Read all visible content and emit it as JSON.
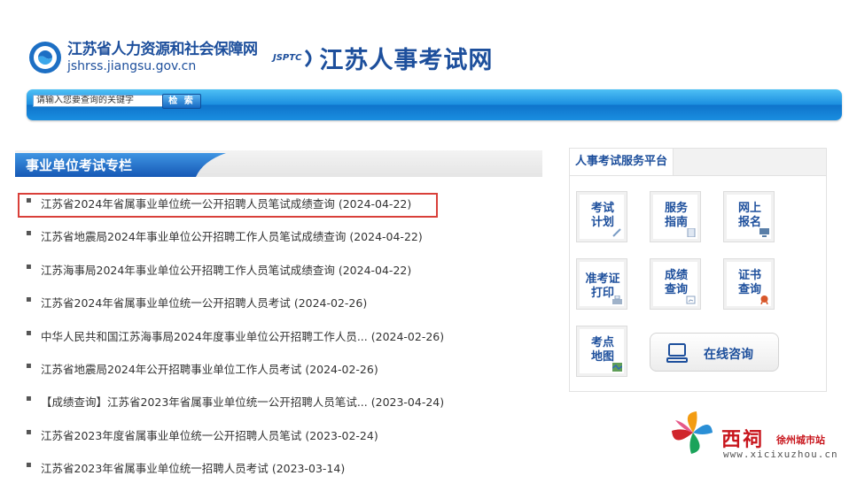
{
  "header": {
    "hrss_name": "江苏省人力资源和社会保障网",
    "hrss_url": "jshrss.jiangsu.gov.cn",
    "jsptc_abbr": "JSPTC",
    "site_name": "江苏人事考试网"
  },
  "search": {
    "placeholder": "请输入您要查询的关键字",
    "button_label": "检 索"
  },
  "left_section": {
    "title": "事业单位考试专栏",
    "items": [
      {
        "title": "江苏省2024年省属事业单位统一公开招聘人员笔试成绩查询",
        "date": "(2024-04-22)"
      },
      {
        "title": "江苏省地震局2024年事业单位公开招聘工作人员笔试成绩查询",
        "date": "(2024-04-22)"
      },
      {
        "title": "江苏海事局2024年事业单位公开招聘工作人员笔试成绩查询",
        "date": "(2024-04-22)"
      },
      {
        "title": "江苏省2024年省属事业单位统一公开招聘人员考试",
        "date": "(2024-02-26)"
      },
      {
        "title": "中华人民共和国江苏海事局2024年度事业单位公开招聘工作人员...",
        "date": "(2024-02-26)"
      },
      {
        "title": "江苏省地震局2024年公开招聘事业单位工作人员考试",
        "date": "(2024-02-26)"
      },
      {
        "title": "【成绩查询】江苏省2023年省属事业单位统一公开招聘人员笔试...",
        "date": "(2023-04-24)"
      },
      {
        "title": "江苏省2023年度省属事业单位统一公开招聘人员笔试",
        "date": "(2023-02-24)"
      },
      {
        "title": "江苏省2023年省属事业单位统一招聘人员考试",
        "date": "(2023-03-14)"
      }
    ]
  },
  "service_platform": {
    "title": "人事考试服务平台",
    "tiles": [
      {
        "line1": "考试",
        "line2": "计划",
        "icon": "pencil-icon"
      },
      {
        "line1": "服务",
        "line2": "指南",
        "icon": "document-icon"
      },
      {
        "line1": "网上",
        "line2": "报名",
        "icon": "computer-icon"
      },
      {
        "line1": "准考证",
        "line2": "打印",
        "icon": "printer-icon"
      },
      {
        "line1": "成绩",
        "line2": "查询",
        "icon": "report-icon"
      },
      {
        "line1": "证书",
        "line2": "查询",
        "icon": "medal-icon"
      },
      {
        "line1": "考点",
        "line2": "地图",
        "icon": "map-icon"
      }
    ],
    "consult_label": "在线咨询"
  },
  "watermark": {
    "brand": "西祠",
    "city": "徐州城市站",
    "site": "www.xicixuzhou.cn"
  },
  "colors": {
    "brand_blue": "#1d4f9c",
    "bar_blue": "#1c8fe0",
    "highlight_red": "#d9403a",
    "watermark_red": "#c8161d"
  }
}
